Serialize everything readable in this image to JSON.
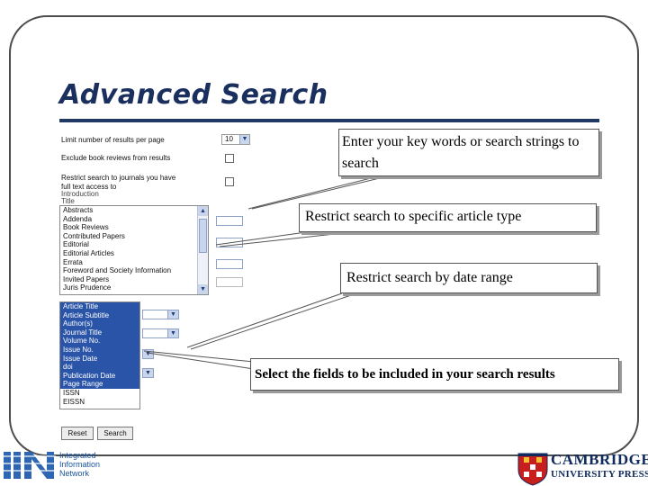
{
  "slide": {
    "title": "Advanced Search"
  },
  "form": {
    "limit_label": "Limit number of results per page",
    "limit_value": "10",
    "exclude_label": "Exclude book reviews from results",
    "restrict_label_line1": "Restrict search to journals you have",
    "restrict_label_line2": "full text access to",
    "article_types_partial": [
      "Introduction",
      "Title"
    ],
    "article_types": [
      "Abstracts",
      "Addenda",
      "Book Reviews",
      "Contributed Papers",
      "Editorial",
      "Editorial Articles",
      "Errata",
      "Foreword and Society Information",
      "Invited Papers",
      "Juris Prudence"
    ],
    "fields": [
      "Article Title",
      "Article Subtitle",
      "Author(s)",
      "Journal Title",
      "Volume No.",
      "Issue No.",
      "Issue Date",
      "doi",
      "Publication Date",
      "Page Range",
      "ISSN",
      "EISSN"
    ],
    "fields_selected_count": 10,
    "reset_label": "Reset",
    "search_label": "Search"
  },
  "callouts": {
    "keywords": "Enter your key words or search strings to search",
    "article_type": "Restrict search to specific article type",
    "date_range": "Restrict search by date range",
    "fields": "Select the fields to be included in your search results"
  },
  "logos": {
    "iin_line1": "Integrated",
    "iin_line2": "Information",
    "iin_line3": "Network",
    "cup_line1": "CAMBRIDGE",
    "cup_line2": "UNIVERSITY PRESS"
  },
  "colors": {
    "title": "#1a2f5e",
    "rule": "#203864",
    "selection": "#2a54a8",
    "iin_blue": "#1a55a0",
    "cup_navy": "#0f2a5c"
  }
}
